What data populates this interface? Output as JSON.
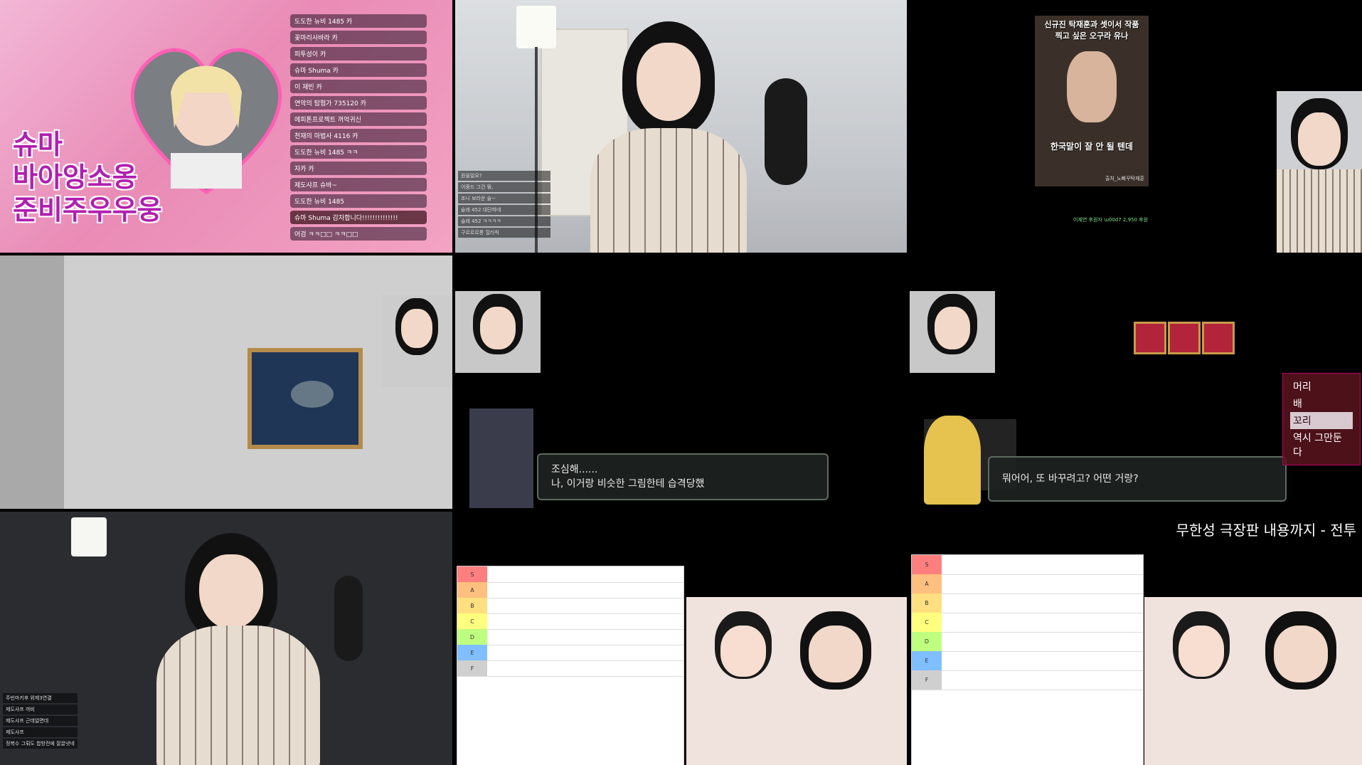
{
  "tile1": {
    "title_lines": [
      "슈마",
      "바아앙소옹",
      "준비주우우웅"
    ],
    "chat": [
      {
        "text": "도도한 뉴비 1485 카"
      },
      {
        "text": "꽃마리사바라 카"
      },
      {
        "text": "피투성이 카"
      },
      {
        "text": "슈마 Shuma 카"
      },
      {
        "text": "이 재빈 카"
      },
      {
        "text": "연악의 탐험가 735120 카"
      },
      {
        "text": "에피톤프로젝트 꺼억귀신"
      },
      {
        "text": "천재의 마법사 4116 카"
      },
      {
        "text": "도도한 뉴비 1485 ㅋㅋ"
      },
      {
        "text": "자카 카"
      },
      {
        "text": "제도샤프 슈바~"
      },
      {
        "text": "도도한 뉴비 1485"
      },
      {
        "text": "슈마 Shuma 감자합니다!!!!!!!!!!!!!!"
      },
      {
        "text": "어검 ㅋㅋ□□ ㅋㅋ□□"
      }
    ]
  },
  "tile2": {
    "chat": [
      "원을일요?",
      "어중드 그건 뭥,",
      "조니 보라운 슬~",
      "슬레 452 대단하네",
      "슬레 452 ㅋㅋㅋㅋ",
      "구르르르롱 힐러칙"
    ]
  },
  "tile3": {
    "clip_caption_top": "신규진 탁재훈과 셋이서 작품찍고 싶은 오구라 유나",
    "clip_caption_bottom": "한국말이 잘 안 될 텐데",
    "clip_source": "출처_노빠꾸탁재훈",
    "donation_line": "이재연 후원자 \\u00d7 2,950 후원"
  },
  "tile5": {
    "dialog_line1": "조심해......",
    "dialog_line2": "나, 이거랑 비슷한 그림한테 습격당했"
  },
  "tile6": {
    "dialog": "뭐어어, 또 바꾸려고? 어떤 거랑?",
    "menu": [
      "머리",
      "배",
      "꼬리",
      "역시 그만둔다"
    ],
    "menu_selected": 2
  },
  "tile9": {
    "subtitle": "무한성 극장판 내용까지 - 전투"
  },
  "tile7": {
    "chat": [
      "주빈마키후 위제3연결",
      "제도샤프 꺄비",
      "제도샤프 근데얼면데",
      "제도샤프",
      "정복수 그뤄도 합방전에 잘끌냇네"
    ]
  },
  "tiers": [
    "S",
    "A",
    "B",
    "C",
    "D",
    "E",
    "F"
  ],
  "colors": {
    "tier_S": "#ff7f7f",
    "tier_A": "#ffbf7f",
    "tier_B": "#ffdf7f",
    "tier_C": "#ffff7f",
    "tier_D": "#bfff7f",
    "tier_E": "#7fbfff",
    "tier_F": "#cfcfcf"
  }
}
